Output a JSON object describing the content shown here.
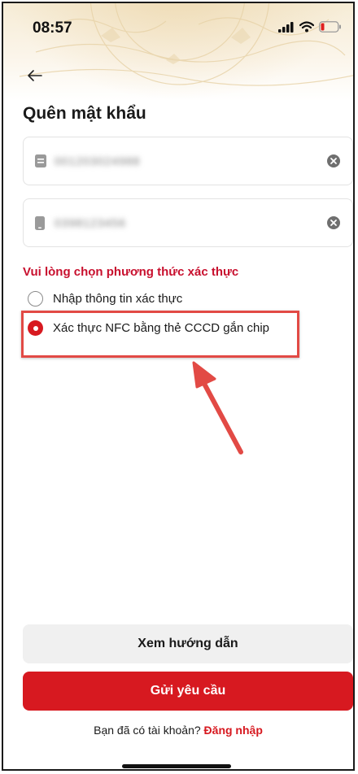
{
  "status_bar": {
    "time": "08:57"
  },
  "page": {
    "title": "Quên mật khẩu"
  },
  "fields": [
    {
      "value": "001203024988",
      "icon": "id-card-icon"
    },
    {
      "value": "0398123456",
      "icon": "phone-icon"
    }
  ],
  "verification": {
    "label": "Vui lòng chọn phương thức xác thực",
    "options": [
      {
        "label": "Nhập thông tin xác thực",
        "selected": false
      },
      {
        "label": "Xác thực NFC bằng thẻ CCCD gắn chip",
        "selected": true
      }
    ]
  },
  "buttons": {
    "guide": "Xem hướng dẫn",
    "submit": "Gửi yêu cầu"
  },
  "footer": {
    "prompt": "Bạn đã có tài khoản?",
    "login_link": "Đăng nhập"
  },
  "colors": {
    "accent": "#d71920",
    "annotation": "#e24a45",
    "guide_bg": "#f0f0f0"
  }
}
